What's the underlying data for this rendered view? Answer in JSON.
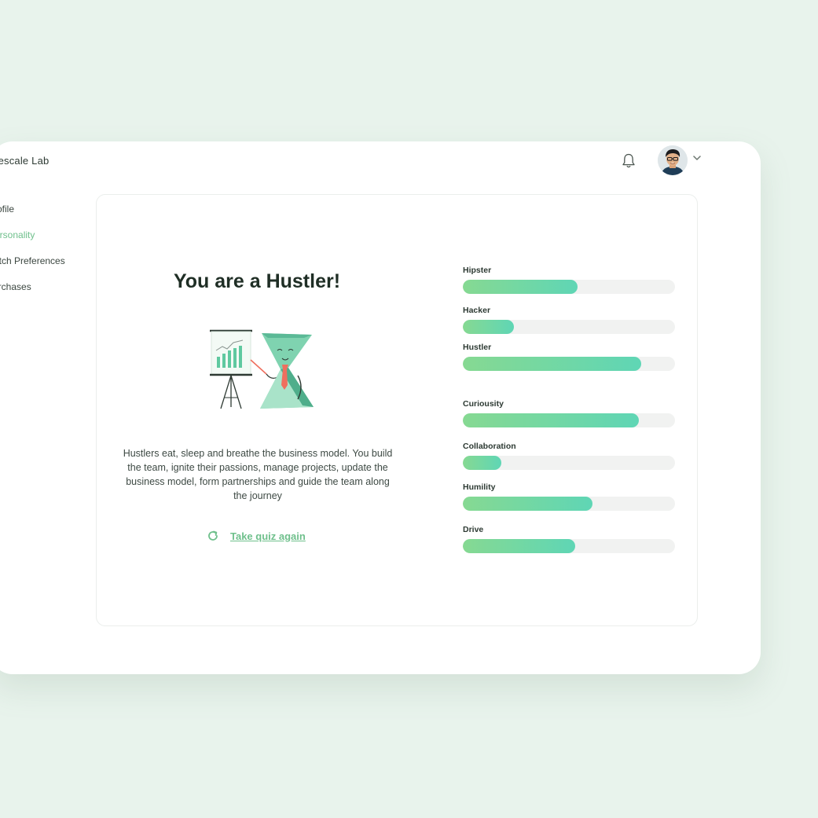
{
  "app": {
    "brand": "Rescale Lab"
  },
  "header": {
    "notifications_icon": "bell-icon",
    "avatar_icon": "user-avatar",
    "menu_icon": "chevron-down-icon"
  },
  "sidebar": {
    "items": [
      {
        "label": "Profile",
        "active": false
      },
      {
        "label": "Personality",
        "active": true
      },
      {
        "label": "Match Preferences",
        "active": false
      },
      {
        "label": "Purchases",
        "active": false
      }
    ]
  },
  "result": {
    "title": "You are a Hustler!",
    "description": "Hustlers eat, sleep and breathe the business model. You build the team, ignite their passions, manage projects, update the business model, form partnerships and guide the team along the journey",
    "retake_label": "Take quiz again",
    "retake_icon": "refresh-icon"
  },
  "traits": [
    {
      "label": "Hipster",
      "level": 0.54
    },
    {
      "label": "Hacker",
      "level": 0.24
    },
    {
      "label": "Hustler",
      "level": 0.84
    },
    {
      "label": "Curiousity",
      "level": 0.83
    },
    {
      "label": "Collaboration",
      "level": 0.18
    },
    {
      "label": "Humility",
      "level": 0.61
    },
    {
      "label": "Drive",
      "level": 0.53
    }
  ],
  "colors": {
    "accent": "#6fc08c",
    "bar_start": "#86d992",
    "bar_end": "#5fd6b5",
    "background": "#e8f3ec"
  }
}
